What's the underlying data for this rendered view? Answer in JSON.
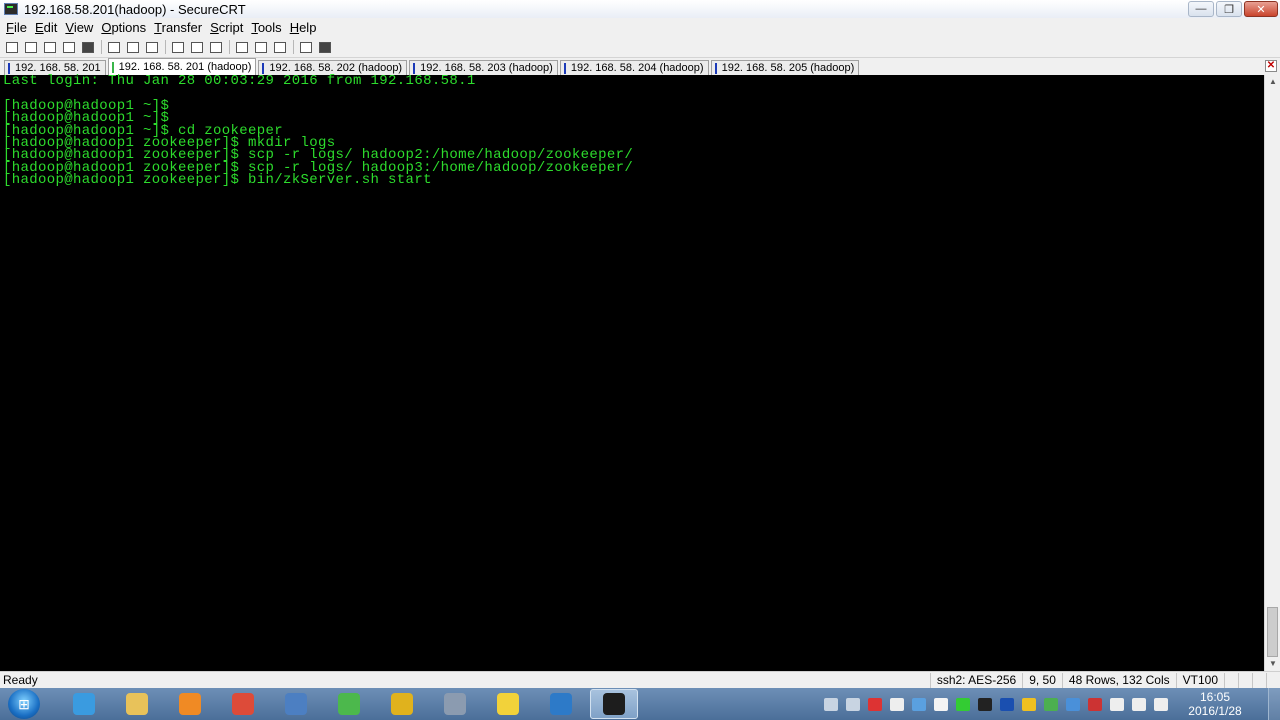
{
  "window": {
    "title": "192.168.58.201(hadoop) - SecureCRT",
    "controls": {
      "minimize": "—",
      "maximize": "❐",
      "close": "✕"
    }
  },
  "menu": [
    "File",
    "Edit",
    "View",
    "Options",
    "Transfer",
    "Script",
    "Tools",
    "Help"
  ],
  "toolbar": [
    "connect-icon",
    "quick-connect-icon",
    "connect-in-tab-icon",
    "reconnect-icon",
    "disconnect-icon",
    "copy-icon",
    "paste-icon",
    "find-icon",
    "send-file-icon",
    "receive-file-icon",
    "print-icon",
    "session-options-icon",
    "global-options-icon",
    "keymap-icon",
    "help-icon",
    "sftp-icon"
  ],
  "tabs": [
    {
      "label": "192. 168. 58. 201",
      "active": false
    },
    {
      "label": "192. 168. 58. 201 (hadoop)",
      "active": true
    },
    {
      "label": "192. 168. 58. 202 (hadoop)",
      "active": false
    },
    {
      "label": "192. 168. 58. 203 (hadoop)",
      "active": false
    },
    {
      "label": "192. 168. 58. 204 (hadoop)",
      "active": false
    },
    {
      "label": "192. 168. 58. 205 (hadoop)",
      "active": false
    }
  ],
  "tab_close": "✕",
  "terminal": {
    "color": "#2ddc2d",
    "lines": [
      "Last login: Thu Jan 28 00:03:29 2016 from 192.168.58.1",
      "",
      "[hadoop@hadoop1 ~]$",
      "[hadoop@hadoop1 ~]$",
      "[hadoop@hadoop1 ~]$ cd zookeeper",
      "[hadoop@hadoop1 zookeeper]$ mkdir logs",
      "[hadoop@hadoop1 zookeeper]$ scp -r logs/ hadoop2:/home/hadoop/zookeeper/",
      "[hadoop@hadoop1 zookeeper]$ scp -r logs/ hadoop3:/home/hadoop/zookeeper/",
      "[hadoop@hadoop1 zookeeper]$ bin/zkServer.sh start"
    ]
  },
  "status": {
    "ready": "Ready",
    "cipher": "ssh2: AES-256",
    "cursor": "9,  50",
    "size": "48 Rows, 132 Cols",
    "emulation": "VT100"
  },
  "taskbar": {
    "start": "start-orb-icon",
    "apps": [
      {
        "name": "internet-explorer-icon",
        "color": "#3a9be0",
        "open": false
      },
      {
        "name": "file-explorer-icon",
        "color": "#e8c25a",
        "open": false
      },
      {
        "name": "media-player-icon",
        "color": "#f08a24",
        "open": false
      },
      {
        "name": "chrome-icon",
        "color": "#dd4b39",
        "open": false
      },
      {
        "name": "network-lock-icon",
        "color": "#4c7fc2",
        "open": false
      },
      {
        "name": "browser-e-icon",
        "color": "#4cb84c",
        "open": false
      },
      {
        "name": "app-e-icon",
        "color": "#e0b21d",
        "open": false
      },
      {
        "name": "remote-desktop-icon",
        "color": "#8b9bb0",
        "open": false
      },
      {
        "name": "music-icon",
        "color": "#f2d23a",
        "open": false
      },
      {
        "name": "virtualbox-icon",
        "color": "#2d7ac8",
        "open": false
      },
      {
        "name": "securecrt-icon",
        "color": "#1d1d1d",
        "open": true
      }
    ],
    "tray": [
      {
        "name": "keyboard-icon",
        "color": "#c8d4e2"
      },
      {
        "name": "pen-icon",
        "color": "#c8d4e2"
      },
      {
        "name": "antivirus-icon",
        "color": "#d33"
      },
      {
        "name": "sync-icon",
        "color": "#eee"
      },
      {
        "name": "security-icon",
        "color": "#5aa0e0"
      },
      {
        "name": "windows-icon",
        "color": "#f4f4f4"
      },
      {
        "name": "green-app-icon",
        "color": "#3c3"
      },
      {
        "name": "qq-icon",
        "color": "#222"
      },
      {
        "name": "bluetooth-icon",
        "color": "#1a4fb0"
      },
      {
        "name": "plus-app-icon",
        "color": "#f0c020"
      },
      {
        "name": "shield-icon",
        "color": "#4caf50"
      },
      {
        "name": "display-icon",
        "color": "#4a90d9"
      },
      {
        "name": "no-network-icon",
        "color": "#cc3333"
      },
      {
        "name": "usb-icon",
        "color": "#eee"
      },
      {
        "name": "volume-icon",
        "color": "#eee"
      },
      {
        "name": "signal-icon",
        "color": "#eee"
      }
    ],
    "time": "16:05",
    "date": "2016/1/28"
  }
}
